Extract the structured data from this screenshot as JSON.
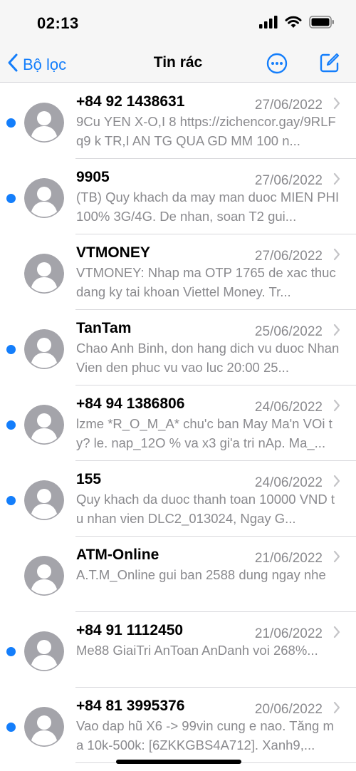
{
  "status_bar": {
    "time": "02:13"
  },
  "nav": {
    "back_label": "Bộ lọc",
    "title": "Tin rác"
  },
  "colors": {
    "accent": "#147efb",
    "secondary_text": "#8a8a8e",
    "avatar_bg": "#a4a4aa",
    "divider": "#d8d8dc"
  },
  "messages": [
    {
      "sender": "+84 92 1438631",
      "date": "27/06/2022",
      "unread": true,
      "preview": "9Cu YEN X-O,I 8 https://zichencor.gay/9RLFq9 k TR,I AN TG QUA GD MM 100 n..."
    },
    {
      "sender": "9905",
      "date": "27/06/2022",
      "unread": true,
      "preview": "(TB) Quy khach da may man duoc MIEN PHI 100% 3G/4G. De nhan, soan T2 gui..."
    },
    {
      "sender": "VTMONEY",
      "date": "27/06/2022",
      "unread": false,
      "preview": "VTMONEY: Nhap ma OTP 1765 de xac thuc dang ky tai khoan Viettel Money. Tr..."
    },
    {
      "sender": "TanTam",
      "date": "25/06/2022",
      "unread": true,
      "preview": "Chao Anh Binh, don hang dich vu duoc Nhan Vien den phuc vu vao luc 20:00 25..."
    },
    {
      "sender": "+84 94 1386806",
      "date": "24/06/2022",
      "unread": true,
      "preview": "lzme *R_O_M_A* chu'c ban May Ma'n VOi ty? le. nap_12O % va x3 gi'a tri nAp. Ma_..."
    },
    {
      "sender": "155",
      "date": "24/06/2022",
      "unread": true,
      "preview": "Quy khach da duoc thanh toan 10000 VND tu nhan vien DLC2_013024, Ngay G..."
    },
    {
      "sender": "ATM-Online",
      "date": "21/06/2022",
      "unread": false,
      "preview": "A.T.M_Online gui ban 2588 dung ngay nhe"
    },
    {
      "sender": "+84 91 1112450",
      "date": "21/06/2022",
      "unread": true,
      "preview": "Me88 GiaiTri AnToan AnDanh voi 268%..."
    },
    {
      "sender": "+84 81 3995376",
      "date": "20/06/2022",
      "unread": true,
      "preview": "Vao dap hũ X6 -> 99vin cung e nao. Tăng ma 10k-500k: [6ZKKGBS4A712]. Xanh9,..."
    }
  ]
}
